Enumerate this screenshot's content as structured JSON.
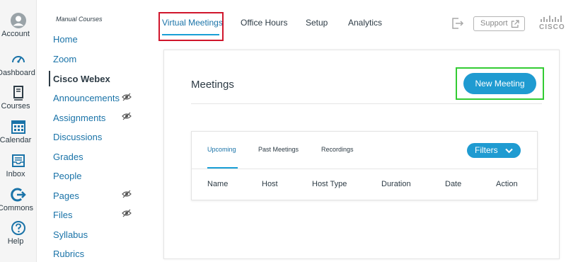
{
  "global_nav": {
    "account": "Account",
    "dashboard": "Dashboard",
    "courses": "Courses",
    "calendar": "Calendar",
    "inbox": "Inbox",
    "commons": "Commons",
    "help": "Help"
  },
  "course_nav": {
    "breadcrumb": "Manual Courses",
    "items": [
      {
        "label": "Home"
      },
      {
        "label": "Zoom"
      },
      {
        "label": "Cisco Webex"
      },
      {
        "label": "Announcements"
      },
      {
        "label": "Assignments"
      },
      {
        "label": "Discussions"
      },
      {
        "label": "Grades"
      },
      {
        "label": "People"
      },
      {
        "label": "Pages"
      },
      {
        "label": "Files"
      },
      {
        "label": "Syllabus"
      },
      {
        "label": "Rubrics"
      }
    ],
    "active": "Cisco Webex"
  },
  "header": {
    "tabs": [
      "Virtual Meetings",
      "Office Hours",
      "Setup",
      "Analytics"
    ],
    "active_tab": "Virtual Meetings",
    "support_label": "Support",
    "brand": "CISCO"
  },
  "meetings": {
    "title": "Meetings",
    "new_button": "New Meeting",
    "tabs": [
      "Upcoming",
      "Past Meetings",
      "Recordings"
    ],
    "active_tab": "Upcoming",
    "filters_label": "Filters",
    "columns": [
      "Name",
      "Host",
      "Host Type",
      "Duration",
      "Date",
      "Action"
    ]
  },
  "colors": {
    "accent": "#1f9bd1",
    "link": "#1a73a8",
    "highlight_red": "#d0162c",
    "highlight_green": "#33cc33"
  }
}
